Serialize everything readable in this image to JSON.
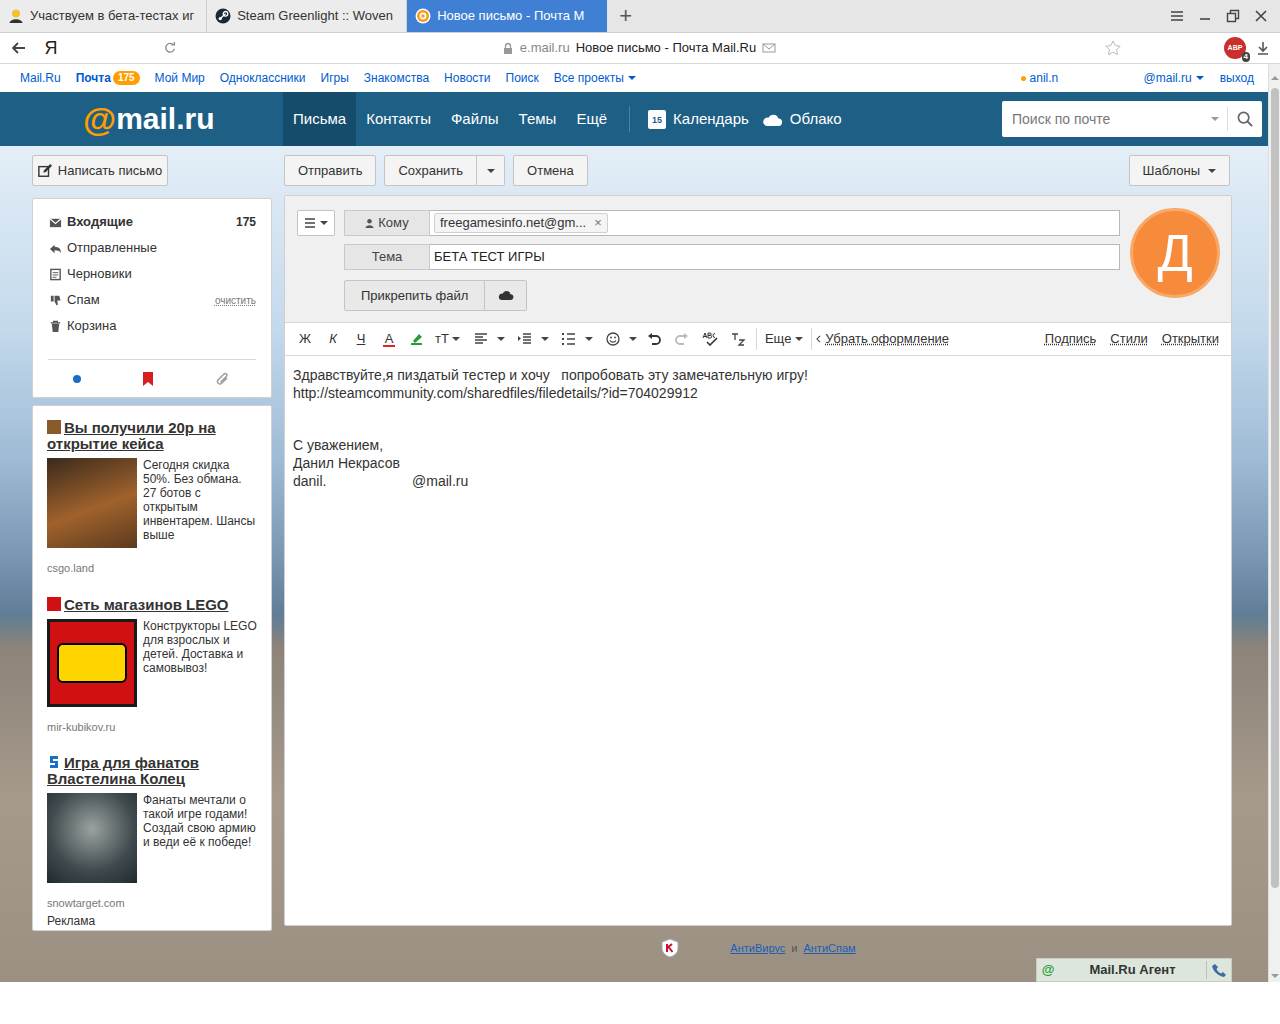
{
  "browser": {
    "tabs": [
      {
        "label": "Участвуем в бета-тестах иг",
        "selected": false
      },
      {
        "label": "Steam Greenlight :: Woven",
        "selected": false
      },
      {
        "label": "Новое письмо - Почта M",
        "selected": true
      }
    ],
    "new_tab": "+",
    "logo": "Я",
    "domain": "e.mail.ru",
    "page_title": "Новое письмо - Почта Mail.Ru",
    "adblock_badge": "ABP",
    "adblock_count": "4"
  },
  "portal": {
    "links": [
      {
        "label": "Mail.Ru",
        "selected": false,
        "dropdown": false
      },
      {
        "label": "Почта",
        "selected": true,
        "dropdown": false,
        "badge": "175"
      },
      {
        "label": "Мой Мир",
        "selected": false,
        "dropdown": false
      },
      {
        "label": "Одноклассники",
        "selected": false,
        "dropdown": false
      },
      {
        "label": "Игры",
        "selected": false,
        "dropdown": false
      },
      {
        "label": "Знакомства",
        "selected": false,
        "dropdown": false
      },
      {
        "label": "Новости",
        "selected": false,
        "dropdown": false
      },
      {
        "label": "Поиск",
        "selected": false,
        "dropdown": false
      },
      {
        "label": "Все проекты",
        "selected": false,
        "dropdown": true
      }
    ],
    "user": "anil.n",
    "user_domain": "@mail.ru",
    "logout": "выход"
  },
  "header": {
    "logo_at": "@",
    "logo_text": "mail.ru",
    "nav": [
      {
        "label": "Письма",
        "selected": true
      },
      {
        "label": "Контакты",
        "selected": false
      },
      {
        "label": "Файлы",
        "selected": false
      },
      {
        "label": "Темы",
        "selected": false
      },
      {
        "label": "Ещё",
        "selected": false
      }
    ],
    "apps": [
      {
        "label": "Календарь",
        "kind": "calendar",
        "day": "15"
      },
      {
        "label": "Облако",
        "kind": "cloud"
      }
    ],
    "search_placeholder": "Поиск по почте"
  },
  "toolbar": {
    "compose": "Написать письмо",
    "send": "Отправить",
    "save": "Сохранить",
    "cancel": "Отмена",
    "templates": "Шаблоны"
  },
  "folders": [
    {
      "label": "Входящие",
      "kind": "inbox",
      "unread": true,
      "count": "175"
    },
    {
      "label": "Отправленные",
      "kind": "sent",
      "unread": false
    },
    {
      "label": "Черновики",
      "kind": "drafts",
      "unread": false
    },
    {
      "label": "Спам",
      "kind": "spam",
      "unread": false,
      "action": "очистить"
    },
    {
      "label": "Корзина",
      "kind": "trash",
      "unread": false
    }
  ],
  "ads": {
    "items": [
      {
        "kind": "case",
        "title": "Вы получили 20р на открытие кейса",
        "text": "Сегодня скидка 50%. Без обмана. 27 ботов с открытым инвентарем. Шансы выше",
        "domain": "csgo.land"
      },
      {
        "kind": "lego",
        "title": "Сеть магазинов LEGO",
        "text": "Конструкторы LEGO для взрослых и детей. Доставка и самовывоз!",
        "domain": "mir-kubikov.ru"
      },
      {
        "kind": "game",
        "title": "Игра для фанатов Властелина Колец",
        "text": "Фанаты мечтали о такой игре годами! Создай свою армию и веди её к победе!",
        "domain": "snowtarget.com"
      }
    ],
    "label": "Реклама"
  },
  "compose": {
    "to_label": "Кому",
    "recipient": "freegamesinfo.net@gm...",
    "remove": "×",
    "subject_label": "Тема",
    "subject": "БЕТА ТЕСТ ИГРЫ",
    "attach": "Прикрепить файл",
    "avatar": "Д"
  },
  "format": {
    "bold": "Ж",
    "italic": "К",
    "underline": "Ч",
    "color": "A",
    "size": "тТ",
    "more": "Еще",
    "clear": "Убрать оформление",
    "right": [
      "Подпись",
      "Стили",
      "Открытки"
    ]
  },
  "body": {
    "paragraphs": [
      [
        "Здравствуйте,я пиздатый тестер и хочу   попробовать эту замечательную игру!",
        "http://steamcommunity.com/sharedfiles/filedetails/?id=704029912"
      ],
      [
        "С уважением,",
        "Данил Некрасов",
        "danil.                      @mail.ru"
      ]
    ]
  },
  "footer": {
    "antivirus": "АнтиВирус",
    "and": "и",
    "antispam": "АнтиСпам",
    "agent": "Mail.Ru Агент",
    "agent_logo": "@"
  }
}
